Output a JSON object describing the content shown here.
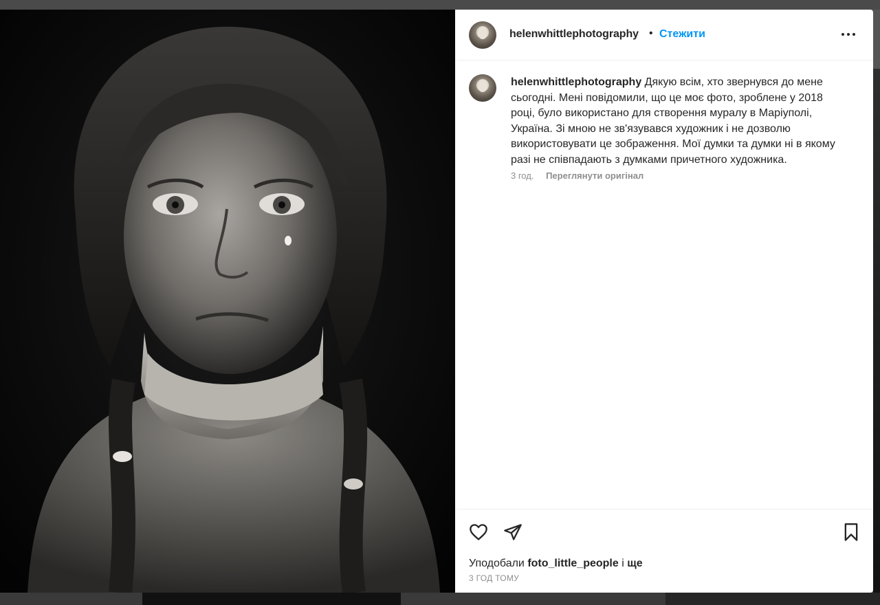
{
  "post": {
    "username": "helenwhittlephotography",
    "separator": "•",
    "follow_label": "Стежити",
    "caption_user": "helenwhittlephotography",
    "caption_text": "Дякую всім, хто звернувся до мене сьогодні. Мені повідомили, що це моє фото, зроблене у 2018 році, було використано для створення муралу в Маріуполі, Україна. Зі мною не зв'язувався художник і не дозволю використовувати це зображення. Мої думки та думки ні в якому разі не співпадають з думками причетного художника.",
    "caption_age": "3 год.",
    "see_original_label": "Переглянути оригінал",
    "liked_by_prefix": "Уподобали",
    "liked_by_user": "foto_little_people",
    "liked_by_and": "і",
    "liked_by_more": "ще",
    "time_ago": "3 ГОД ТОМУ"
  },
  "icons": {
    "like": "heart-icon",
    "share": "paper-plane-icon",
    "save": "bookmark-icon",
    "more": "more-options-icon"
  },
  "colors": {
    "accent": "#0095f6",
    "text": "#262626",
    "secondary_text": "#8e8e8e"
  }
}
